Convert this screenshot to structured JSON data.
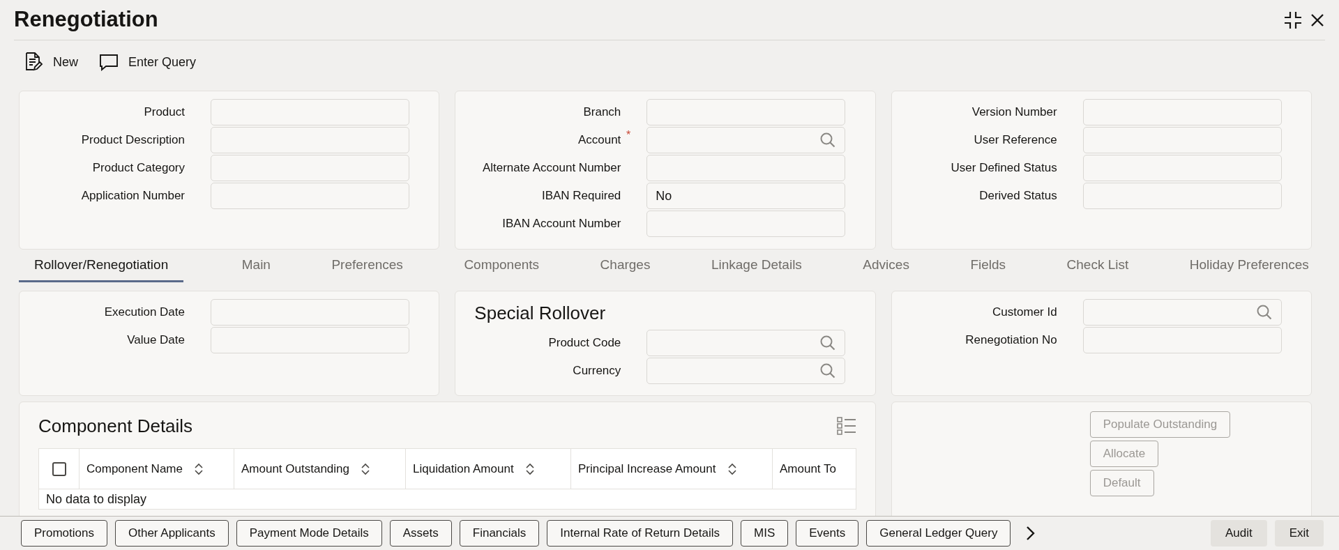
{
  "window": {
    "title": "Renegotiation"
  },
  "toolbar": [
    {
      "kind": "new",
      "label": "New"
    },
    {
      "kind": "query",
      "label": "Enter Query"
    }
  ],
  "header_panels": [
    {
      "fields": [
        {
          "label": "Product"
        },
        {
          "label": "Product Description"
        },
        {
          "label": "Product Category"
        },
        {
          "label": "Application Number"
        }
      ]
    },
    {
      "fields": [
        {
          "label": "Branch"
        },
        {
          "label": "Account",
          "required_mark": "*",
          "lookup": true
        },
        {
          "label": "Alternate Account Number"
        },
        {
          "label": "IBAN Required",
          "value": "No"
        },
        {
          "label": "IBAN Account Number"
        }
      ]
    },
    {
      "fields": [
        {
          "label": "Version Number"
        },
        {
          "label": "User Reference"
        },
        {
          "label": "User Defined Status"
        },
        {
          "label": "Derived Status"
        }
      ]
    }
  ],
  "tabs": [
    {
      "label": "Rollover/Renegotiation",
      "selected": true
    },
    {
      "label": "Main",
      "selected": false
    },
    {
      "label": "Preferences",
      "selected": false
    },
    {
      "label": "Components",
      "selected": false
    },
    {
      "label": "Charges",
      "selected": false
    },
    {
      "label": "Linkage Details",
      "selected": false
    },
    {
      "label": "Advices",
      "selected": false
    },
    {
      "label": "Fields",
      "selected": false
    },
    {
      "label": "Check List",
      "selected": false
    },
    {
      "label": "Holiday Preferences",
      "selected": false
    }
  ],
  "rollover_panels": [
    {
      "fields": [
        {
          "label": "Execution Date"
        },
        {
          "label": "Value Date"
        }
      ]
    },
    {
      "title": "Special Rollover",
      "fields": [
        {
          "label": "Product Code",
          "lookup": true
        },
        {
          "label": "Currency",
          "lookup": true
        }
      ]
    },
    {
      "fields": [
        {
          "label": "Customer Id",
          "lookup": true
        },
        {
          "label": "Renegotiation No"
        }
      ]
    }
  ],
  "component_details": {
    "title": "Component Details",
    "select_all": {
      "checked": false
    },
    "columns": [
      {
        "label": "Component Name",
        "sortable": true
      },
      {
        "label": "Amount Outstanding",
        "sortable": true
      },
      {
        "label": "Liquidation Amount",
        "sortable": true
      },
      {
        "label": "Principal Increase Amount",
        "sortable": true
      },
      {
        "label": "Amount To"
      }
    ],
    "empty_message": "No data to display"
  },
  "action_buttons": [
    {
      "label": "Populate Outstanding",
      "disabled": true
    },
    {
      "label": "Allocate",
      "disabled": true
    },
    {
      "label": "Default",
      "disabled": true
    }
  ],
  "footer_buttons": [
    {
      "label": "Promotions",
      "kind": "outlined"
    },
    {
      "label": "Other Applicants",
      "kind": "outlined"
    },
    {
      "label": "Payment Mode Details",
      "kind": "outlined"
    },
    {
      "label": "Assets",
      "kind": "outlined"
    },
    {
      "label": "Financials",
      "kind": "outlined"
    },
    {
      "label": "Internal Rate of Return Details",
      "kind": "outlined"
    },
    {
      "label": "MIS",
      "kind": "outlined"
    },
    {
      "label": "Events",
      "kind": "outlined"
    },
    {
      "label": "General Ledger Query",
      "kind": "outlined"
    },
    {
      "kind": "next"
    },
    {
      "label": "Audit",
      "kind": "plain"
    },
    {
      "label": "Exit",
      "kind": "plain"
    }
  ]
}
